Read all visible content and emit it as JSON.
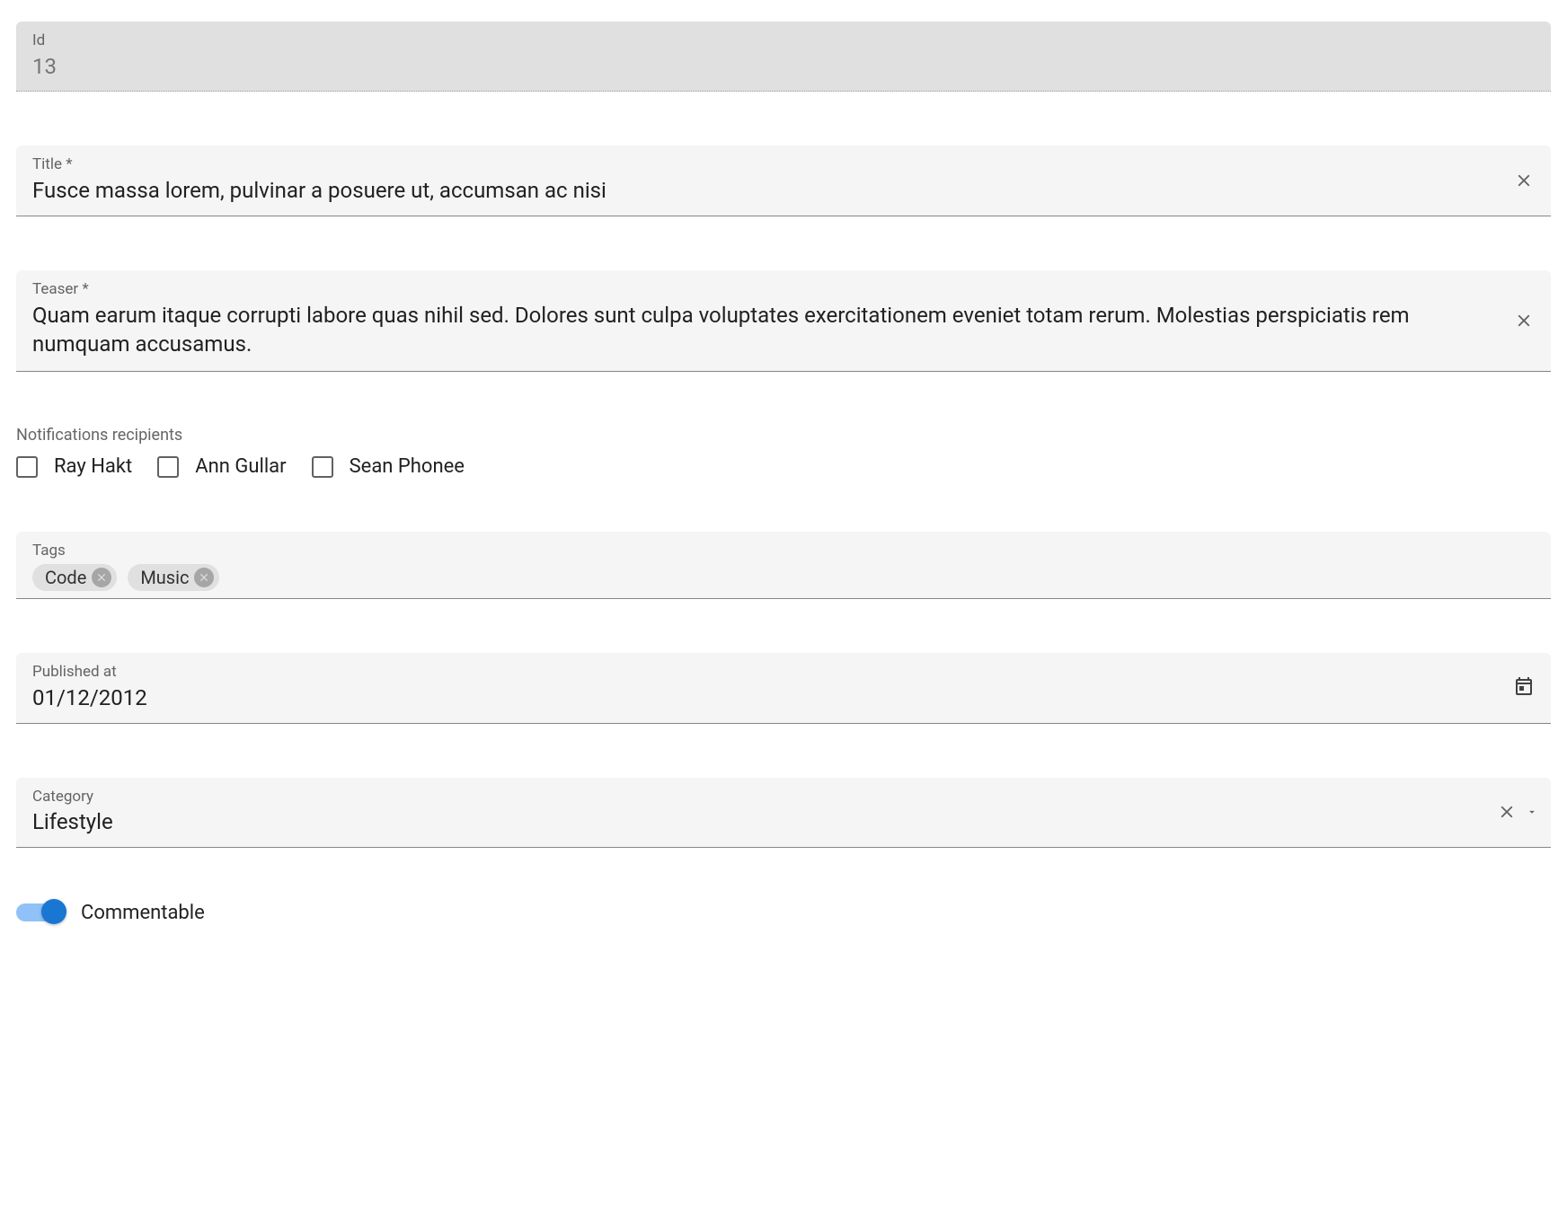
{
  "id_field": {
    "label": "Id",
    "value": "13"
  },
  "title_field": {
    "label": "Title *",
    "value": "Fusce massa lorem, pulvinar a posuere ut, accumsan ac nisi"
  },
  "teaser_field": {
    "label": "Teaser *",
    "value": "Quam earum itaque corrupti labore quas nihil sed. Dolores sunt culpa voluptates exercitationem eveniet totam rerum. Molestias perspiciatis rem numquam accusamus."
  },
  "notifications": {
    "label": "Notifications recipients",
    "options": [
      "Ray Hakt",
      "Ann Gullar",
      "Sean Phonee"
    ]
  },
  "tags_field": {
    "label": "Tags",
    "chips": [
      "Code",
      "Music"
    ]
  },
  "published_field": {
    "label": "Published at",
    "value": "01/12/2012"
  },
  "category_field": {
    "label": "Category",
    "value": "Lifestyle"
  },
  "commentable": {
    "label": "Commentable",
    "value": true
  }
}
